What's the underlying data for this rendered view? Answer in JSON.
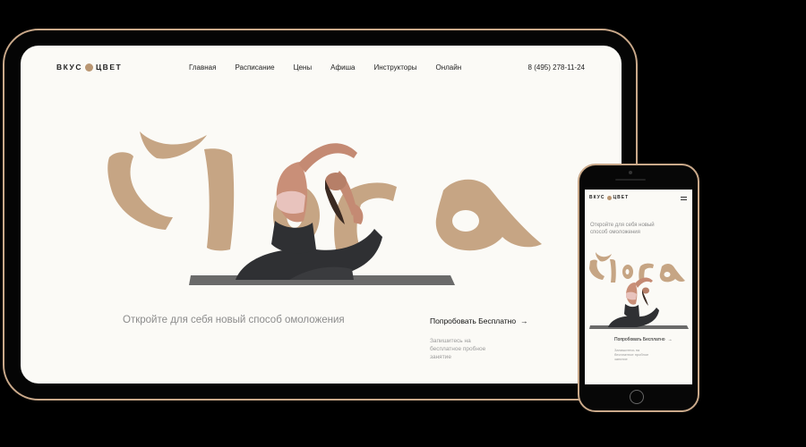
{
  "brand": {
    "logo_left": "ВКУС",
    "logo_right": "ЦВЕТ",
    "accent_color": "#c4a07c"
  },
  "nav": {
    "items": [
      {
        "label": "Главная"
      },
      {
        "label": "Расписание"
      },
      {
        "label": "Цены"
      },
      {
        "label": "Афиша"
      },
      {
        "label": "Инструкторы"
      },
      {
        "label": "Онлайн"
      }
    ]
  },
  "contact": {
    "phone": "8 (495) 278-11-24"
  },
  "hero": {
    "title": "Йога",
    "subtitle": "Откройте для себя новый способ омоложения",
    "cta_label": "Попробовать Бесплатно",
    "cta_arrow": "→",
    "cta_note": "Запишитесь на бесплатное пробное занятие"
  },
  "mobile": {
    "menu_icon": "burger-menu-icon"
  }
}
